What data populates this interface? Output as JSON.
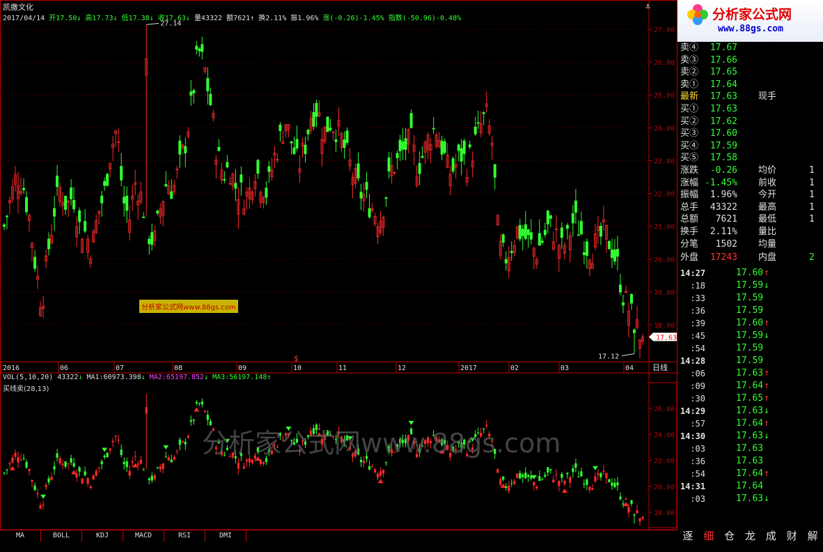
{
  "stock": {
    "name": "凯撒文化",
    "timeframe": "日线",
    "cursor_label": "$"
  },
  "info_bar": {
    "date": "2017/04/14",
    "open": "开17.50",
    "high": "高17.73",
    "low": "低17.38",
    "close": "收17.63",
    "vol": "量43322",
    "amount": "额7621",
    "turnover": "换2.11%",
    "amplitude": "振1.96%",
    "change": "涨(-0.26)-1.45%",
    "index": "指数(-50.96)-0.48%"
  },
  "colors": {
    "up": "#ff2a2a",
    "down": "#33ff33",
    "axis": "#c00000",
    "white": "#e0e0e0"
  },
  "main_chart": {
    "y_ticks": [
      "27.00",
      "26.00",
      "25.00",
      "24.00",
      "23.00",
      "22.00",
      "21.00",
      "20.00",
      "19.00",
      "18.00"
    ],
    "x_ticks": [
      "2016",
      "06",
      "07",
      "08",
      "09",
      "10",
      "11",
      "12",
      "2017",
      "02",
      "03",
      "04"
    ],
    "high_label": "27.14",
    "low_label": "17.12",
    "last_price": "17.63"
  },
  "watermark_small": "分析家公式网www.88gs.com",
  "watermark_big": "分析家公式网www.88gs.com",
  "logo": {
    "title": "分析家公式网",
    "url": "www.88gs.com"
  },
  "sub_chart": {
    "vol_label": "VOL(5,10,20)",
    "vol_value": "43322",
    "ma1": "MA1:60973.398",
    "ma2": "MA2:65197.852",
    "ma3": "MA3:56197.148",
    "indicator_label": "买线卖(28,13)",
    "y_ticks": [
      "26.00",
      "24.00",
      "22.00",
      "20.00",
      "18.00"
    ]
  },
  "indicator_tabs": [
    "MA",
    "BOLL",
    "KDJ",
    "MACD",
    "RSI",
    "DMI"
  ],
  "order_book": {
    "asks": [
      {
        "label": "卖④",
        "price": "17.67"
      },
      {
        "label": "卖③",
        "price": "17.66"
      },
      {
        "label": "卖②",
        "price": "17.65"
      },
      {
        "label": "卖①",
        "price": "17.64"
      }
    ],
    "latest": {
      "label": "最新",
      "price": "17.63",
      "extra": "现手"
    },
    "bids": [
      {
        "label": "买①",
        "price": "17.63"
      },
      {
        "label": "买②",
        "price": "17.62"
      },
      {
        "label": "买③",
        "price": "17.60"
      },
      {
        "label": "买④",
        "price": "17.59"
      },
      {
        "label": "买⑤",
        "price": "17.58"
      }
    ]
  },
  "stats": [
    {
      "label": "涨跌",
      "value": "-0.26",
      "label2": "均价",
      "value2": "1"
    },
    {
      "label": "涨幅",
      "value": "-1.45%",
      "label2": "前收",
      "value2": "1"
    },
    {
      "label": "振幅",
      "value": "1.96%",
      "label2": "今开",
      "value2": "1"
    },
    {
      "label": "总手",
      "value": "43322",
      "label2": "最高",
      "value2": "1"
    },
    {
      "label": "总额",
      "value": "7621",
      "label2": "最低",
      "value2": "1"
    },
    {
      "label": "换手",
      "value": "2.11%",
      "label2": "量比",
      "value2": ""
    },
    {
      "label": "分笔",
      "value": "1502",
      "label2": "均量",
      "value2": ""
    }
  ],
  "outer_inner": {
    "outer_label": "外盘",
    "outer_value": "17243",
    "inner_label": "内盘",
    "inner_value": "2"
  },
  "ticks": [
    {
      "time": "14:27",
      "price": "17.60",
      "dir": "up",
      "major": true
    },
    {
      "time": ":18",
      "price": "17.59",
      "dir": "down",
      "major": false
    },
    {
      "time": ":33",
      "price": "17.59",
      "dir": "",
      "major": false
    },
    {
      "time": ":36",
      "price": "17.59",
      "dir": "",
      "major": false
    },
    {
      "time": ":39",
      "price": "17.60",
      "dir": "up",
      "major": false
    },
    {
      "time": ":45",
      "price": "17.59",
      "dir": "down",
      "major": false
    },
    {
      "time": ":54",
      "price": "17.59",
      "dir": "",
      "major": false
    },
    {
      "time": "14:28",
      "price": "17.59",
      "dir": "",
      "major": true
    },
    {
      "time": ":06",
      "price": "17.63",
      "dir": "up",
      "major": false
    },
    {
      "time": ":09",
      "price": "17.64",
      "dir": "up",
      "major": false
    },
    {
      "time": ":30",
      "price": "17.65",
      "dir": "up",
      "major": false
    },
    {
      "time": "14:29",
      "price": "17.63",
      "dir": "down",
      "major": true
    },
    {
      "time": ":57",
      "price": "17.64",
      "dir": "up",
      "major": false
    },
    {
      "time": "14:30",
      "price": "17.63",
      "dir": "down",
      "major": true
    },
    {
      "time": ":03",
      "price": "17.63",
      "dir": "",
      "major": false
    },
    {
      "time": ":36",
      "price": "17.63",
      "dir": "",
      "major": false
    },
    {
      "time": ":54",
      "price": "17.64",
      "dir": "up",
      "major": false
    },
    {
      "time": "14:31",
      "price": "17.64",
      "dir": "",
      "major": true
    },
    {
      "time": ":03",
      "price": "17.63",
      "dir": "down",
      "major": false
    }
  ],
  "right_tabs": [
    "逐",
    "细",
    "仓",
    "龙",
    "成",
    "财",
    "解"
  ],
  "chart_data": {
    "type": "candlestick",
    "title": "凯撒文化 日线",
    "ylim": [
      17.0,
      27.3
    ],
    "x_range": [
      "2016-05",
      "2017-04"
    ],
    "key_points": [
      {
        "label": "high",
        "value": 27.14
      },
      {
        "label": "low",
        "value": 17.12
      },
      {
        "label": "last",
        "value": 17.63
      }
    ],
    "approx_path": [
      21.0,
      21.8,
      22.6,
      22.3,
      21.3,
      19.8,
      18.6,
      20.2,
      21.5,
      22.2,
      21.6,
      22.0,
      21.0,
      20.8,
      20.3,
      21.4,
      22.0,
      23.3,
      24.0,
      21.8,
      21.2,
      22.4,
      21.8,
      20.8,
      20.5,
      21.6,
      22.4,
      22.1,
      22.8,
      23.6,
      24.8,
      26.4,
      25.8,
      24.7,
      23.2,
      22.6,
      22.8,
      22.2,
      22.0,
      21.9,
      22.8,
      22.4,
      22.0,
      23.0,
      23.6,
      24.2,
      23.5,
      22.8,
      23.4,
      24.4,
      24.6,
      23.8,
      24.2,
      24.0,
      23.6,
      23.0,
      22.4,
      22.0,
      21.8,
      21.5,
      21.2,
      22.0,
      22.8,
      23.0,
      23.4,
      23.6,
      22.8,
      23.2,
      23.8,
      24.0,
      23.4,
      22.6,
      22.8,
      23.2,
      22.9,
      23.4,
      24.0,
      24.4,
      23.5,
      20.4,
      20.0,
      20.4,
      20.9,
      20.7,
      20.5,
      20.2,
      20.6,
      21.0,
      20.8,
      20.3,
      20.6,
      21.2,
      20.9,
      20.4,
      20.3,
      20.6,
      20.8,
      20.4,
      19.8,
      18.8,
      18.4,
      17.9,
      17.6
    ]
  }
}
